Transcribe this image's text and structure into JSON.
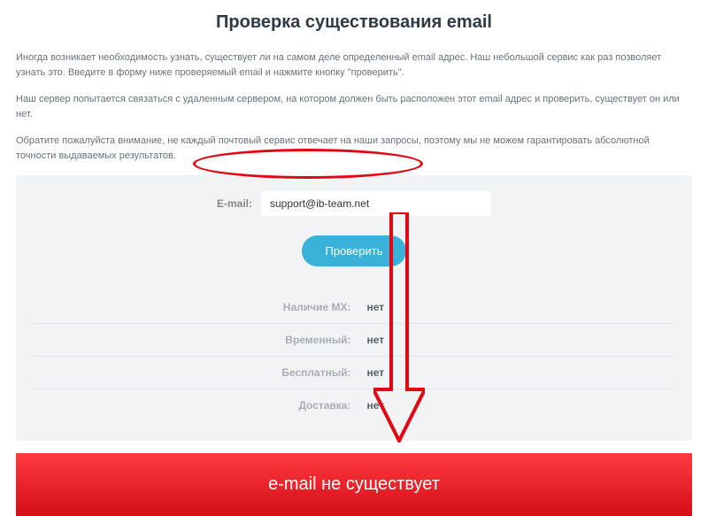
{
  "title": "Проверка существования email",
  "desc1": "Иногда возникает необходимость узнать, существует ли на самом деле определенный email адрес. Наш небольшой сервис как раз позволяет узнать это. Введите в форму ниже проверяемый email и нажмите кнопку \"проверить\".",
  "desc2": "Наш сервер попытается связаться с удаленным сервером, на котором должен быть расположен этот email адрес и проверить, существует он или нет.",
  "desc3": "Обратите пожалуйста внимание, не каждый почтовый сервис отвечает на наши запросы, поэтому мы не можем гарантировать абсолютной точности выдаваемых результатов.",
  "form": {
    "email_label": "E-mail:",
    "email_value": "support@ib-team.net",
    "check_label": "Проверить"
  },
  "results": [
    {
      "label": "Наличие MX:",
      "value": "нет"
    },
    {
      "label": "Временный:",
      "value": "нет"
    },
    {
      "label": "Бесплатный:",
      "value": "нет"
    },
    {
      "label": "Доставка:",
      "value": "нет"
    }
  ],
  "banner": "e-mail не существует"
}
